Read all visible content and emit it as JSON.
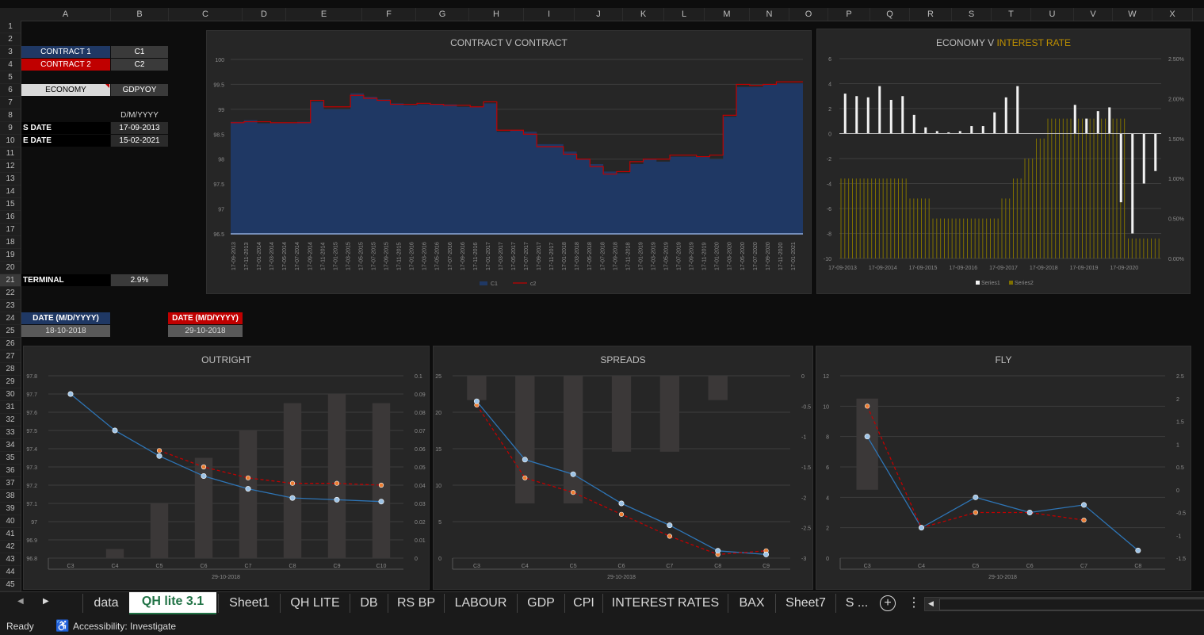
{
  "columns": [
    "A",
    "B",
    "C",
    "D",
    "E",
    "F",
    "G",
    "H",
    "I",
    "J",
    "K",
    "L",
    "M",
    "N",
    "O",
    "P",
    "Q",
    "R",
    "S",
    "T",
    "U",
    "V",
    "W",
    "X"
  ],
  "rows": [
    "1",
    "2",
    "3",
    "4",
    "5",
    "6",
    "7",
    "8",
    "9",
    "10",
    "11",
    "12",
    "13",
    "14",
    "15",
    "16",
    "17",
    "18",
    "19",
    "20",
    "21",
    "22",
    "23",
    "24",
    "25",
    "26",
    "27",
    "28",
    "29",
    "30",
    "31",
    "32",
    "33",
    "34",
    "35",
    "36",
    "37",
    "38",
    "39",
    "40",
    "41",
    "42",
    "43",
    "44",
    "45"
  ],
  "cells": {
    "contract1_label": "CONTRACT 1",
    "contract1_value": "C1",
    "contract2_label": "CONTRACT 2",
    "contract2_value": "C2",
    "economy_label": "ECONOMY",
    "economy_value": "GDPYOY",
    "date_format": "D/M/YYYY",
    "sdate_label": "S DATE",
    "sdate_value": "17-09-2013",
    "edate_label": "E DATE",
    "edate_value": "15-02-2021",
    "terminal_label": "TERMINAL",
    "terminal_value": "2.9%",
    "date1_label": "DATE (M/D/YYYY)",
    "date1_value": "18-10-2018",
    "date2_label": "DATE (M/D/YYYY)",
    "date2_value": "29-10-2018"
  },
  "colors": {
    "blue": "#1f3864",
    "red": "#c00000",
    "gold": "#bf9000",
    "panel": "#262626",
    "line_blue": "#2e75b6",
    "dot_blue": "#9dc3e6",
    "dot_orange": "#ed7d31",
    "bar_dark": "#3b3838"
  },
  "charts": {
    "contract": {
      "title": "CONTRACT V CONTRACT",
      "legend": [
        "C1",
        "c2"
      ],
      "yticks": [
        "100",
        "99.5",
        "99",
        "98.5",
        "98",
        "97.5",
        "97",
        "96.5"
      ],
      "xticks": [
        "17-09-2013",
        "17-11-2013",
        "17-01-2014",
        "17-03-2014",
        "17-05-2014",
        "17-07-2014",
        "17-09-2014",
        "17-11-2014",
        "17-01-2015",
        "17-03-2015",
        "17-05-2015",
        "17-07-2015",
        "17-09-2015",
        "17-11-2015",
        "17-01-2016",
        "17-03-2016",
        "17-05-2016",
        "17-07-2016",
        "17-09-2016",
        "17-11-2016",
        "17-01-2017",
        "17-03-2017",
        "17-05-2017",
        "17-07-2017",
        "17-09-2017",
        "17-11-2017",
        "17-01-2018",
        "17-03-2018",
        "17-05-2018",
        "17-07-2018",
        "17-09-2018",
        "17-11-2018",
        "17-01-2019",
        "17-03-2019",
        "17-05-2019",
        "17-07-2019",
        "17-09-2019",
        "17-11-2019",
        "17-01-2020",
        "17-03-2020",
        "17-05-2020",
        "17-07-2020",
        "17-09-2020",
        "17-11-2020",
        "17-01-2021"
      ]
    },
    "economy": {
      "title_a": "ECONOMY V ",
      "title_b": "INTEREST RATE",
      "legend": [
        "Series1",
        "Series2"
      ],
      "yticks_left": [
        "6",
        "4",
        "2",
        "0",
        "-2",
        "-4",
        "-6",
        "-8",
        "-10"
      ],
      "yticks_right": [
        "2.50%",
        "2.00%",
        "1.50%",
        "1.00%",
        "0.50%",
        "0.00%"
      ],
      "xticks": [
        "17-09-2013",
        "17-09-2014",
        "17-09-2015",
        "17-09-2016",
        "17-09-2017",
        "17-09-2018",
        "17-09-2019",
        "17-09-2020"
      ]
    },
    "outright": {
      "title": "OUTRIGHT",
      "date": "29-10-2018",
      "categories": [
        "C3",
        "C4",
        "C5",
        "C6",
        "C7",
        "C8",
        "C9",
        "C10"
      ],
      "yticks_left": [
        "97.8",
        "97.7",
        "97.6",
        "97.5",
        "97.4",
        "97.3",
        "97.2",
        "97.1",
        "97",
        "96.9",
        "96.8"
      ],
      "yticks_right": [
        "0.1",
        "0.09",
        "0.08",
        "0.07",
        "0.06",
        "0.05",
        "0.04",
        "0.03",
        "0.02",
        "0.01",
        "0"
      ]
    },
    "spreads": {
      "title": "SPREADS",
      "date": "29-10-2018",
      "categories": [
        "C3",
        "C4",
        "C5",
        "C6",
        "C7",
        "C8",
        "C9"
      ],
      "yticks_left": [
        "25",
        "20",
        "15",
        "10",
        "5",
        "0"
      ],
      "yticks_right": [
        "0",
        "-0.5",
        "-1",
        "-1.5",
        "-2",
        "-2.5",
        "-3"
      ]
    },
    "fly": {
      "title": "FLY",
      "date": "29-10-2018",
      "categories": [
        "C3",
        "C4",
        "C5",
        "C6",
        "C7",
        "C8"
      ],
      "yticks_left": [
        "12",
        "10",
        "8",
        "6",
        "4",
        "2",
        "0"
      ],
      "yticks_right": [
        "2.5",
        "2",
        "1.5",
        "1",
        "0.5",
        "0",
        "-0.5",
        "-1",
        "-1.5"
      ]
    }
  },
  "chart_data": [
    {
      "type": "area",
      "title": "CONTRACT V CONTRACT",
      "ylim": [
        96.5,
        100
      ],
      "series": [
        {
          "name": "C1",
          "values": [
            98.75,
            98.78,
            98.72,
            98.72,
            98.72,
            98.75,
            99.15,
            99.0,
            99.0,
            99.32,
            99.25,
            99.2,
            99.12,
            99.08,
            99.1,
            99.1,
            99.1,
            99.05,
            99.05,
            99.12,
            98.55,
            98.58,
            98.55,
            98.3,
            98.3,
            98.15,
            98.0,
            97.9,
            97.75,
            97.72,
            97.9,
            98.0,
            97.95,
            98.05,
            98.05,
            98.05,
            98.0,
            98.85,
            99.45,
            99.45,
            99.5,
            99.52,
            99.52
          ]
        },
        {
          "name": "c2",
          "values": [
            98.73,
            98.75,
            98.75,
            98.73,
            98.73,
            98.73,
            99.18,
            99.05,
            99.05,
            99.28,
            99.22,
            99.18,
            99.1,
            99.1,
            99.12,
            99.1,
            99.08,
            99.08,
            99.05,
            99.15,
            98.58,
            98.58,
            98.5,
            98.25,
            98.25,
            98.1,
            98.0,
            97.85,
            97.7,
            97.75,
            97.95,
            98.0,
            98.0,
            98.08,
            98.08,
            98.05,
            98.08,
            98.88,
            99.5,
            99.48,
            99.5,
            99.55,
            99.55
          ]
        }
      ]
    },
    {
      "type": "bar",
      "title": "ECONOMY V INTEREST RATE",
      "series": [
        {
          "name": "Series1",
          "values": [
            3.2,
            3.0,
            2.9,
            3.8,
            2.7,
            3.0,
            1.5,
            0.5,
            0.2,
            0.1,
            0.2,
            0.6,
            0.6,
            1.7,
            2.9,
            3.8,
            0,
            0,
            0,
            0,
            2.3,
            1.2,
            1.8,
            2.1,
            -5.5,
            -8.0,
            -4.0,
            -3.0
          ]
        },
        {
          "name": "Series2",
          "values": [
            1.0,
            1.0,
            1.0,
            1.0,
            1.0,
            1.0,
            0.75,
            0.75,
            0.5,
            0.5,
            0.5,
            0.5,
            0.5,
            0.5,
            0.75,
            1.0,
            1.25,
            1.5,
            1.75,
            1.75,
            1.75,
            1.75,
            1.75,
            1.75,
            1.75,
            0.25,
            0.25,
            0.25
          ]
        }
      ]
    },
    {
      "type": "bar",
      "title": "OUTRIGHT",
      "categories": [
        "C3",
        "C4",
        "C5",
        "C6",
        "C7",
        "C8",
        "C9",
        "C10"
      ],
      "series": [
        {
          "name": "bars",
          "values": [
            0,
            0.005,
            0.03,
            0.055,
            0.07,
            0.085,
            0.09,
            0.085
          ]
        },
        {
          "name": "blue",
          "values": [
            97.7,
            97.5,
            97.36,
            97.25,
            97.18,
            97.13,
            97.12,
            97.11
          ]
        },
        {
          "name": "red",
          "values": [
            null,
            null,
            97.39,
            97.3,
            97.24,
            97.21,
            97.21,
            97.2
          ]
        }
      ]
    },
    {
      "type": "bar",
      "title": "SPREADS",
      "categories": [
        "C3",
        "C4",
        "C5",
        "C6",
        "C7",
        "C8",
        "C9"
      ],
      "series": [
        {
          "name": "bars",
          "values": [
            -0.4,
            -2.1,
            -2.1,
            -1.25,
            -1.25,
            -0.4,
            0
          ]
        },
        {
          "name": "blue",
          "values": [
            21.5,
            13.5,
            11.5,
            7.5,
            4.5,
            1.0,
            0.5
          ]
        },
        {
          "name": "red",
          "values": [
            21.0,
            11.0,
            9.0,
            6.0,
            3.0,
            0.5,
            1.0
          ]
        }
      ]
    },
    {
      "type": "bar",
      "title": "FLY",
      "categories": [
        "C3",
        "C4",
        "C5",
        "C6",
        "C7",
        "C8"
      ],
      "series": [
        {
          "name": "bars",
          "values": [
            2.0,
            0,
            0,
            0,
            0,
            0
          ]
        },
        {
          "name": "blue",
          "values": [
            8.0,
            2.0,
            4.0,
            3.0,
            3.5,
            0.5
          ]
        },
        {
          "name": "red",
          "values": [
            10.0,
            2.0,
            3.0,
            3.0,
            2.5,
            null
          ]
        }
      ]
    }
  ],
  "tabs": [
    "data",
    "QH lite 3.1",
    "Sheet1",
    "QH LITE",
    "DB",
    "RS BP",
    "LABOUR",
    "GDP",
    "CPI",
    "INTEREST RATES",
    "BAX",
    "Sheet7",
    "S ..."
  ],
  "active_tab": "QH lite 3.1",
  "status": {
    "ready": "Ready",
    "accessibility": "Accessibility: Investigate"
  }
}
